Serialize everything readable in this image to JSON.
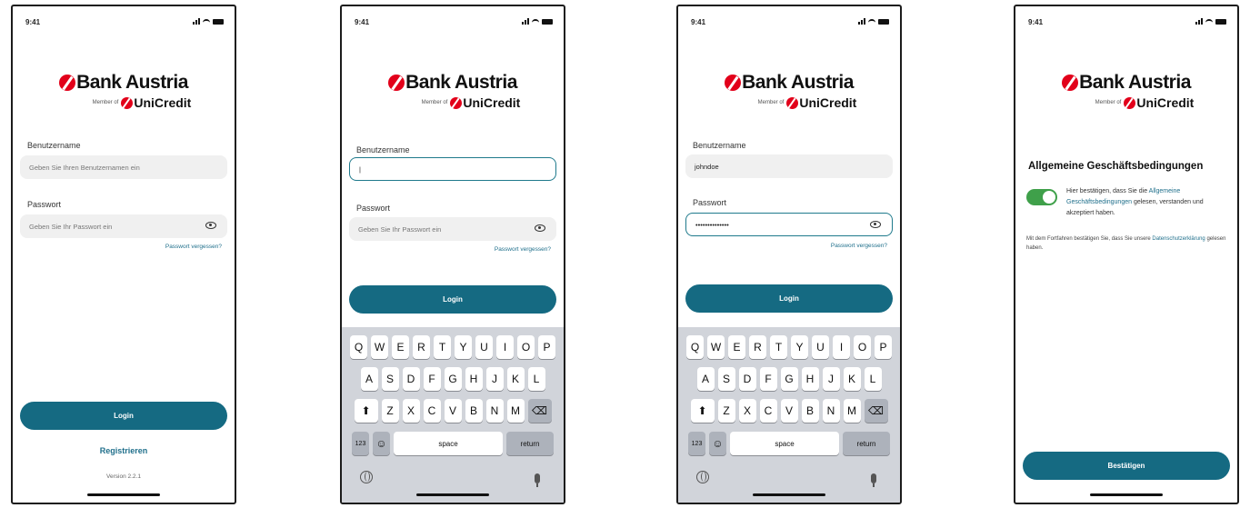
{
  "status": {
    "time": "9:41"
  },
  "brand": {
    "name": "Bank Austria",
    "member": "Member of",
    "parent": "UniCredit"
  },
  "login": {
    "username_label": "Benutzername",
    "username_placeholder": "Geben Sie Ihren Benutzernamen ein",
    "password_label": "Passwort",
    "password_placeholder": "Geben Sie Ihr Passwort ein",
    "forgot": "Passwort vergessen?",
    "button": "Login",
    "register": "Registrieren",
    "version": "Version 2.2.1"
  },
  "screen2": {
    "username_value": "|"
  },
  "screen3": {
    "username_value": "johndoe",
    "password_value": "••••••••••••••"
  },
  "keyboard": {
    "row1": [
      "Q",
      "W",
      "E",
      "R",
      "T",
      "Y",
      "U",
      "I",
      "O",
      "P"
    ],
    "row2": [
      "A",
      "S",
      "D",
      "F",
      "G",
      "H",
      "J",
      "K",
      "L"
    ],
    "row3": [
      "Z",
      "X",
      "C",
      "V",
      "B",
      "N",
      "M"
    ],
    "numbers": "123",
    "emoji": "☺",
    "space": "space",
    "return": "return",
    "shift": "⬆",
    "delete": "⌫"
  },
  "terms": {
    "title": "Allgemeine Geschäftsbedingungen",
    "text_before": "Hier bestätigen, dass Sie die ",
    "link": "Allgemeine Geschäftsbedingungen",
    "text_after": " gelesen, verstanden und akzeptiert haben.",
    "privacy_before": "Mit dem Fortfahren bestätigen Sie, dass Sie unsere ",
    "privacy_link": "Datenschutzerklärung",
    "privacy_after": " gelesen haben.",
    "button": "Bestätigen",
    "accepted": true
  },
  "colors": {
    "primary": "#156a82",
    "brand_red": "#e2001a",
    "toggle_on": "#3fa04a"
  }
}
